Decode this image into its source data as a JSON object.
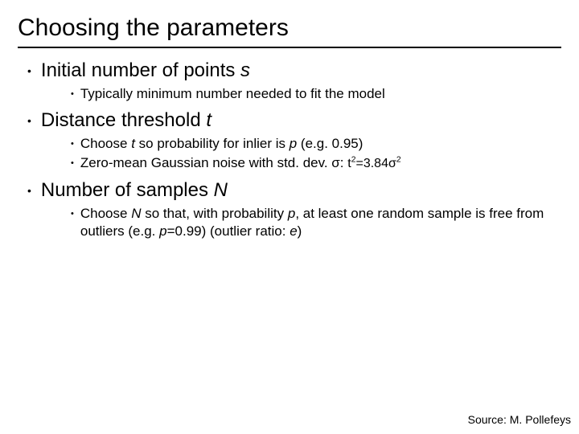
{
  "title": "Choosing the parameters",
  "points": {
    "p1": {
      "label_pre": "Initial number of points ",
      "var": "s",
      "sub1": "Typically minimum number needed to fit the model"
    },
    "p2": {
      "label_pre": "Distance threshold ",
      "var": "t",
      "sub1_a": "Choose ",
      "sub1_var": "t",
      "sub1_b": " so probability for inlier is ",
      "sub1_var2": "p",
      "sub1_c": " (e.g. 0.95)",
      "sub2_a": "Zero-mean Gaussian noise with std. dev. σ: ",
      "sub2_formula_t": "t",
      "sub2_formula_exp": "2",
      "sub2_formula_eq": "=3.84σ",
      "sub2_formula_exp2": "2"
    },
    "p3": {
      "label_pre": "Number of samples ",
      "var": "N",
      "sub1_a": "Choose ",
      "sub1_var": "N",
      "sub1_b": " so that, with probability ",
      "sub1_var2": "p",
      "sub1_c": ", at least one random sample is free from outliers (e.g. ",
      "sub1_var3": "p",
      "sub1_d": "=0.99) (outlier ratio: ",
      "sub1_var4": "e",
      "sub1_e": ")"
    }
  },
  "source": "Source: M. Pollefeys"
}
